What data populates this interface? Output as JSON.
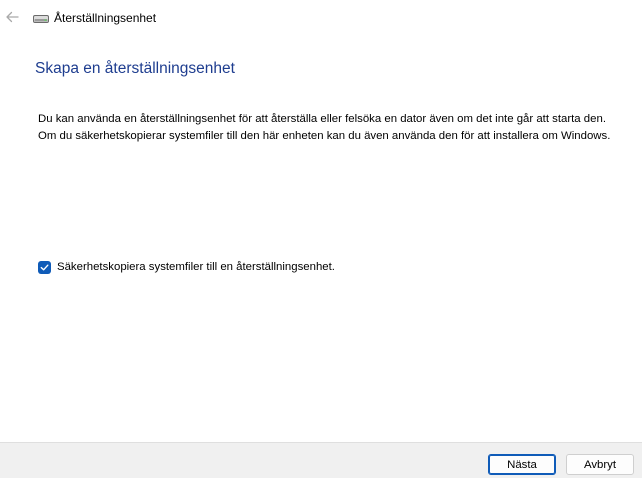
{
  "window": {
    "title": "Återställningsenhet",
    "icon": "drive-icon"
  },
  "header": {
    "back_icon": "back-arrow-icon"
  },
  "main": {
    "heading": "Skapa en återställningsenhet",
    "description": "Du kan använda en återställningsenhet för att återställa eller felsöka en dator även om det inte går att starta den. Om du säkerhetskopierar systemfiler till den här enheten kan du även använda den för att installera om Windows.",
    "backup_checkbox": {
      "label": "Säkerhetskopiera systemfiler till en återställningsenhet.",
      "checked": true
    }
  },
  "footer": {
    "next_label": "Nästa",
    "cancel_label": "Avbryt"
  },
  "colors": {
    "accent": "#0f5bb8",
    "heading": "#1e3d8f",
    "footer_bg": "#f0f0f0"
  }
}
